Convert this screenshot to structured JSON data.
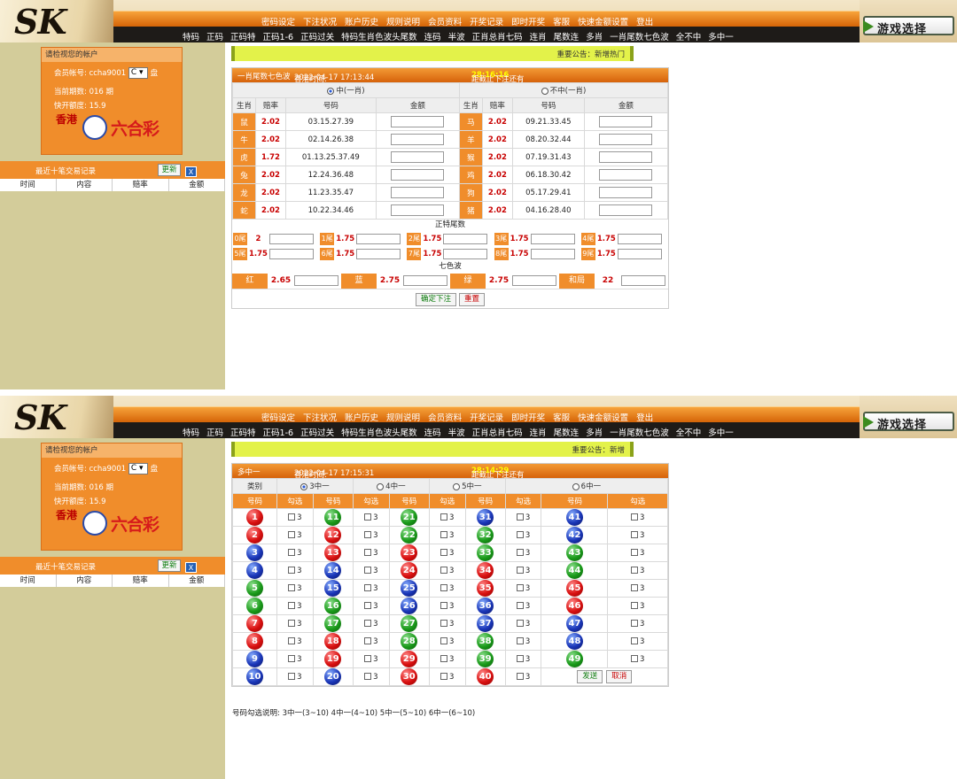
{
  "header": {
    "logo_text": "SK",
    "game_select": "游戏选择",
    "menu_top": [
      "密码设定",
      "下注状况",
      "账户历史",
      "规则说明",
      "会员资料",
      "开奖记录",
      "即时开奖",
      "客服",
      "快速金额设置",
      "登出"
    ],
    "menu_bottom": [
      "特码",
      "正码",
      "正码特",
      "正码1-6",
      "正码过关",
      "特码生肖色波头尾数",
      "连码",
      "半波",
      "正肖总肖七码",
      "连肖",
      "尾数连",
      "多肖",
      "一肖尾数七色波",
      "全不中",
      "多中一"
    ]
  },
  "sidebar": {
    "title": "请检视您的帐户",
    "account_label": "会员帐号:",
    "account_value": "ccha9001",
    "account_select": "C",
    "account_suffix": "盘",
    "period_label": "当前期数:",
    "period_value": "016 期",
    "quick_label": "快开额度:",
    "quick_value": "15.9",
    "brand_left": "香港",
    "brand_right": "六合彩",
    "recent_title": "最近十笔交易记录",
    "update_button": "更新",
    "close_button": "X",
    "recent_columns": [
      "时间",
      "内容",
      "赔率",
      "金额"
    ]
  },
  "shot1": {
    "notice": "重要公告：新增热门",
    "panel_title": "一肖尾数七色波",
    "time_label": "香港时间:",
    "time_value": "2022-04-17 17:13:44",
    "countdown_label": "距截止下注还有",
    "countdown_value": "28:16:16",
    "option_hit": "中(一肖)",
    "option_miss": "不中(一肖)",
    "col_headers": [
      "生肖",
      "赔率",
      "号码",
      "金额",
      "生肖",
      "赔率",
      "号码",
      "金额"
    ],
    "zodiac_rows": [
      {
        "l_name": "鼠",
        "l_odds": "2.02",
        "l_nums": "03.15.27.39",
        "r_name": "马",
        "r_odds": "2.02",
        "r_nums": "09.21.33.45"
      },
      {
        "l_name": "牛",
        "l_odds": "2.02",
        "l_nums": "02.14.26.38",
        "r_name": "羊",
        "r_odds": "2.02",
        "r_nums": "08.20.32.44"
      },
      {
        "l_name": "虎",
        "l_odds": "1.72",
        "l_nums": "01.13.25.37.49",
        "r_name": "猴",
        "r_odds": "2.02",
        "r_nums": "07.19.31.43"
      },
      {
        "l_name": "兔",
        "l_odds": "2.02",
        "l_nums": "12.24.36.48",
        "r_name": "鸡",
        "r_odds": "2.02",
        "r_nums": "06.18.30.42"
      },
      {
        "l_name": "龙",
        "l_odds": "2.02",
        "l_nums": "11.23.35.47",
        "r_name": "狗",
        "r_odds": "2.02",
        "r_nums": "05.17.29.41"
      },
      {
        "l_name": "蛇",
        "l_odds": "2.02",
        "l_nums": "10.22.34.46",
        "r_name": "猪",
        "r_odds": "2.02",
        "r_nums": "04.16.28.40"
      }
    ],
    "tail_title": "正特尾数",
    "tails": [
      {
        "label": "0尾",
        "odds": "2"
      },
      {
        "label": "1尾",
        "odds": "1.75"
      },
      {
        "label": "2尾",
        "odds": "1.75"
      },
      {
        "label": "3尾",
        "odds": "1.75"
      },
      {
        "label": "4尾",
        "odds": "1.75"
      },
      {
        "label": "5尾",
        "odds": "1.75"
      },
      {
        "label": "6尾",
        "odds": "1.75"
      },
      {
        "label": "7尾",
        "odds": "1.75"
      },
      {
        "label": "8尾",
        "odds": "1.75"
      },
      {
        "label": "9尾",
        "odds": "1.75"
      }
    ],
    "color_title": "七色波",
    "colors": [
      {
        "label": "红",
        "odds": "2.65"
      },
      {
        "label": "蓝",
        "odds": "2.75"
      },
      {
        "label": "绿",
        "odds": "2.75"
      },
      {
        "label": "和局",
        "odds": "22"
      }
    ],
    "confirm_button": "确定下注",
    "reset_button": "重置"
  },
  "shot2": {
    "notice": "重要公告：新增",
    "panel_title": "多中一",
    "time_label": "香港时间:",
    "time_value": "2022-04-17 17:15:31",
    "countdown_label": "距截止下注还有",
    "countdown_value": "28:14:29",
    "category_label": "类别",
    "categories": [
      "3中一",
      "4中一",
      "5中一",
      "6中一"
    ],
    "col_num": "号码",
    "col_pick": "勾选",
    "pick_value": "3",
    "numbers": [
      [
        "1",
        "11",
        "21",
        "31",
        "41"
      ],
      [
        "2",
        "12",
        "22",
        "32",
        "42"
      ],
      [
        "3",
        "13",
        "23",
        "33",
        "43"
      ],
      [
        "4",
        "14",
        "24",
        "34",
        "44"
      ],
      [
        "5",
        "15",
        "25",
        "35",
        "45"
      ],
      [
        "6",
        "16",
        "26",
        "36",
        "46"
      ],
      [
        "7",
        "17",
        "27",
        "37",
        "47"
      ],
      [
        "8",
        "18",
        "28",
        "38",
        "48"
      ],
      [
        "9",
        "19",
        "29",
        "39",
        "49"
      ],
      [
        "10",
        "20",
        "30",
        "40",
        ""
      ]
    ],
    "send_button": "发送",
    "cancel_button": "取消",
    "legend": "号码勾选说明: 3中一(3~10) 4中一(4~10) 5中一(5~10) 6中一(6~10)"
  },
  "colors": {
    "orange": "#f08d2b",
    "sidebar": "#d3cc9a",
    "notice": "#e3f24a",
    "red": "#d91010",
    "blue": "#1a36b8",
    "green": "#1a9a1a"
  }
}
